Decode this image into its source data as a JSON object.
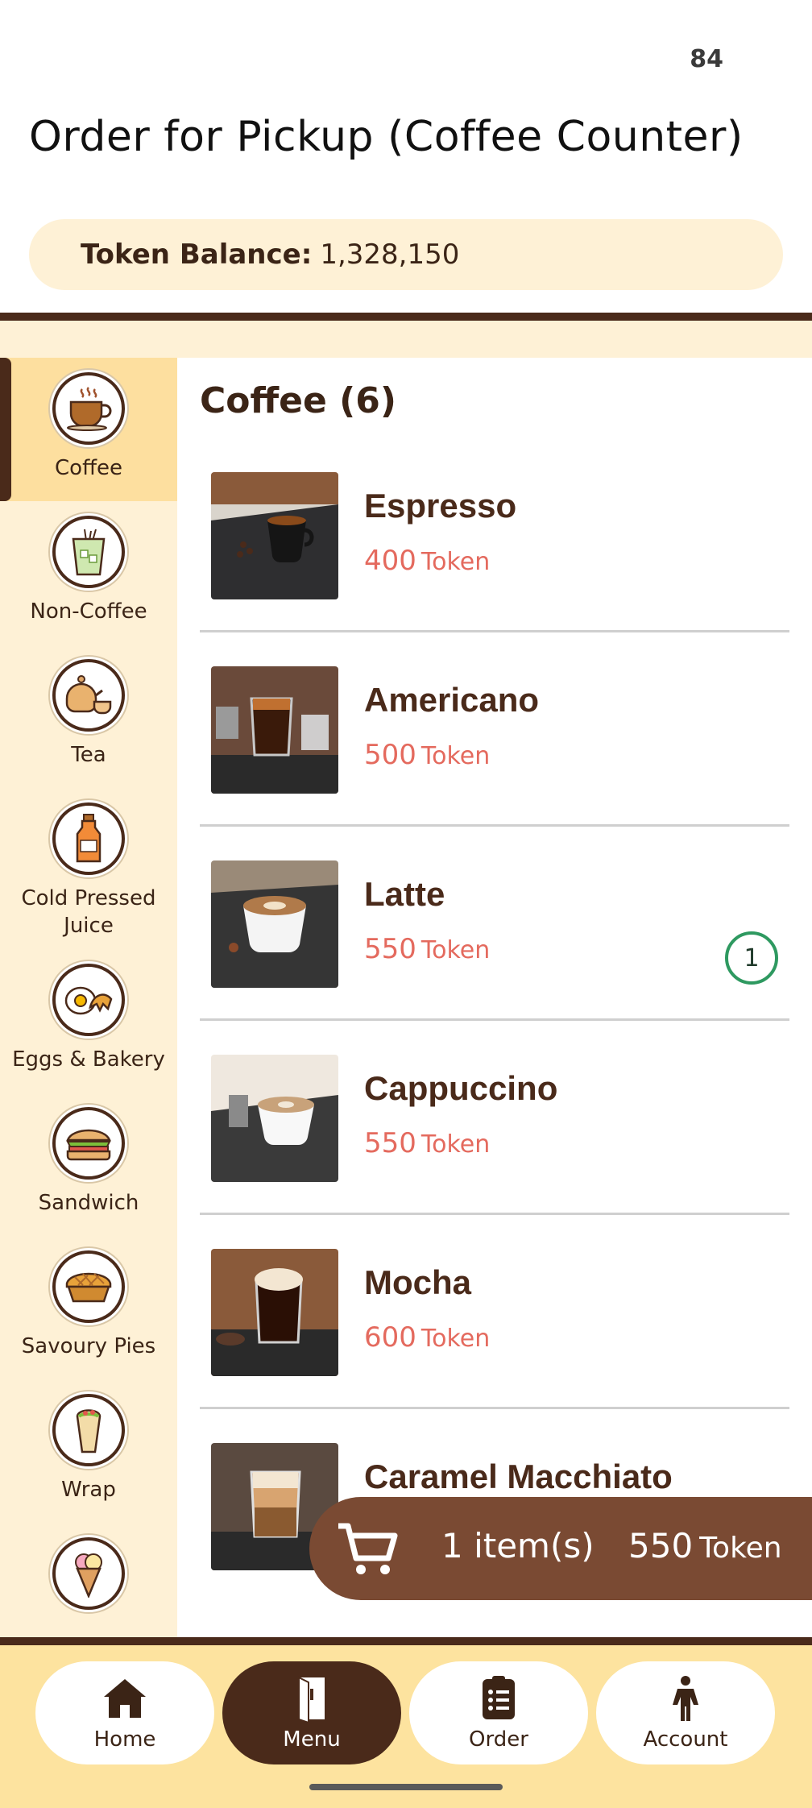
{
  "status_bar": {
    "value": "84"
  },
  "page_title": "Order for Pickup (Coffee Counter)",
  "token_balance": {
    "label": "Token Balance:",
    "value": "1,328,150"
  },
  "categories": [
    {
      "label": "Coffee",
      "icon": "coffee-cup-icon",
      "active": true
    },
    {
      "label": "Non-Coffee",
      "icon": "iced-drink-icon"
    },
    {
      "label": "Tea",
      "icon": "teapot-icon"
    },
    {
      "label": "Cold Pressed\nJuice",
      "icon": "juice-bottle-icon"
    },
    {
      "label": "Eggs & Bakery",
      "icon": "egg-croissant-icon"
    },
    {
      "label": "Sandwich",
      "icon": "sandwich-icon"
    },
    {
      "label": "Savoury Pies",
      "icon": "pie-icon"
    },
    {
      "label": "Wrap",
      "icon": "wrap-icon"
    },
    {
      "label": "",
      "icon": "ice-cream-icon"
    }
  ],
  "section": {
    "title": "Coffee (6)"
  },
  "items": [
    {
      "name": "Espresso",
      "price": "400",
      "unit": "Token"
    },
    {
      "name": "Americano",
      "price": "500",
      "unit": "Token"
    },
    {
      "name": "Latte",
      "price": "550",
      "unit": "Token",
      "quantity": "1"
    },
    {
      "name": "Cappuccino",
      "price": "550",
      "unit": "Token"
    },
    {
      "name": "Mocha",
      "price": "600",
      "unit": "Token"
    },
    {
      "name": "Caramel Macchiato",
      "price": "",
      "unit": ""
    }
  ],
  "cart": {
    "count_label": "1 item(s)",
    "total": "550",
    "unit": "Token",
    "icon": "cart-icon"
  },
  "bottom_nav": [
    {
      "label": "Home",
      "icon": "home-icon"
    },
    {
      "label": "Menu",
      "icon": "menu-book-icon",
      "active": true
    },
    {
      "label": "Order",
      "icon": "clipboard-icon"
    },
    {
      "label": "Account",
      "icon": "person-icon"
    }
  ],
  "colors": {
    "brown": "#4a2a1a",
    "cream": "#fef1d6",
    "price": "#e46a5e",
    "cart": "#7a4a33",
    "nav_bg": "#fde39f",
    "badge_green": "#2e9960"
  }
}
